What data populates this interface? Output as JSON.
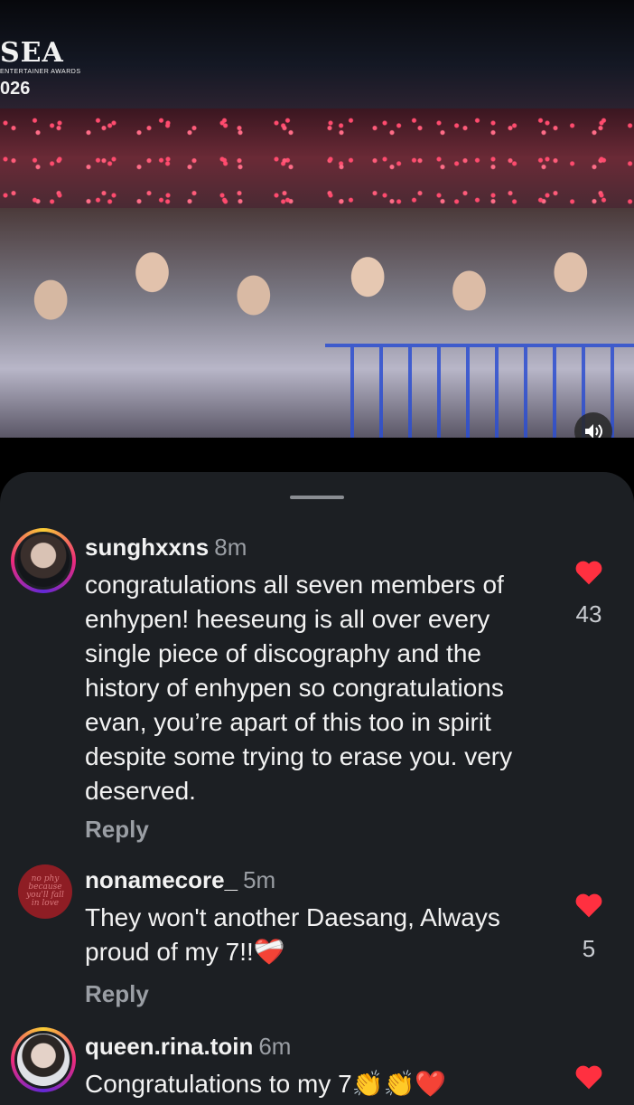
{
  "video": {
    "logo_mark": "SEA",
    "logo_sub": "ENTERTAINER AWARDS",
    "logo_year": "026",
    "mute_icon": "speaker-icon"
  },
  "comments": [
    {
      "username": "sunghxxns",
      "time": "8m",
      "text": "congratulations all seven members of enhypen! heeseung is all over every single piece of discography and the history of enhypen so congratulations evan, you’re apart of this too in spirit despite some trying to erase you. very deserved.",
      "reply": "Reply",
      "likes": "43"
    },
    {
      "username": "nonamecore_",
      "time": "5m",
      "avatar_text": "no phy because you'll fall in love",
      "text": "They won't another Daesang, Always proud of my 7!!❤️‍🩹",
      "reply": "Reply",
      "likes": "5"
    },
    {
      "username": "queen.rina.toin",
      "time": "6m",
      "text": "Congratulations to my 7👏👏❤️"
    }
  ],
  "colors": {
    "sheet_bg": "#1c1f23",
    "like_red": "#ff3040",
    "muted_text": "#9a9ea4"
  }
}
